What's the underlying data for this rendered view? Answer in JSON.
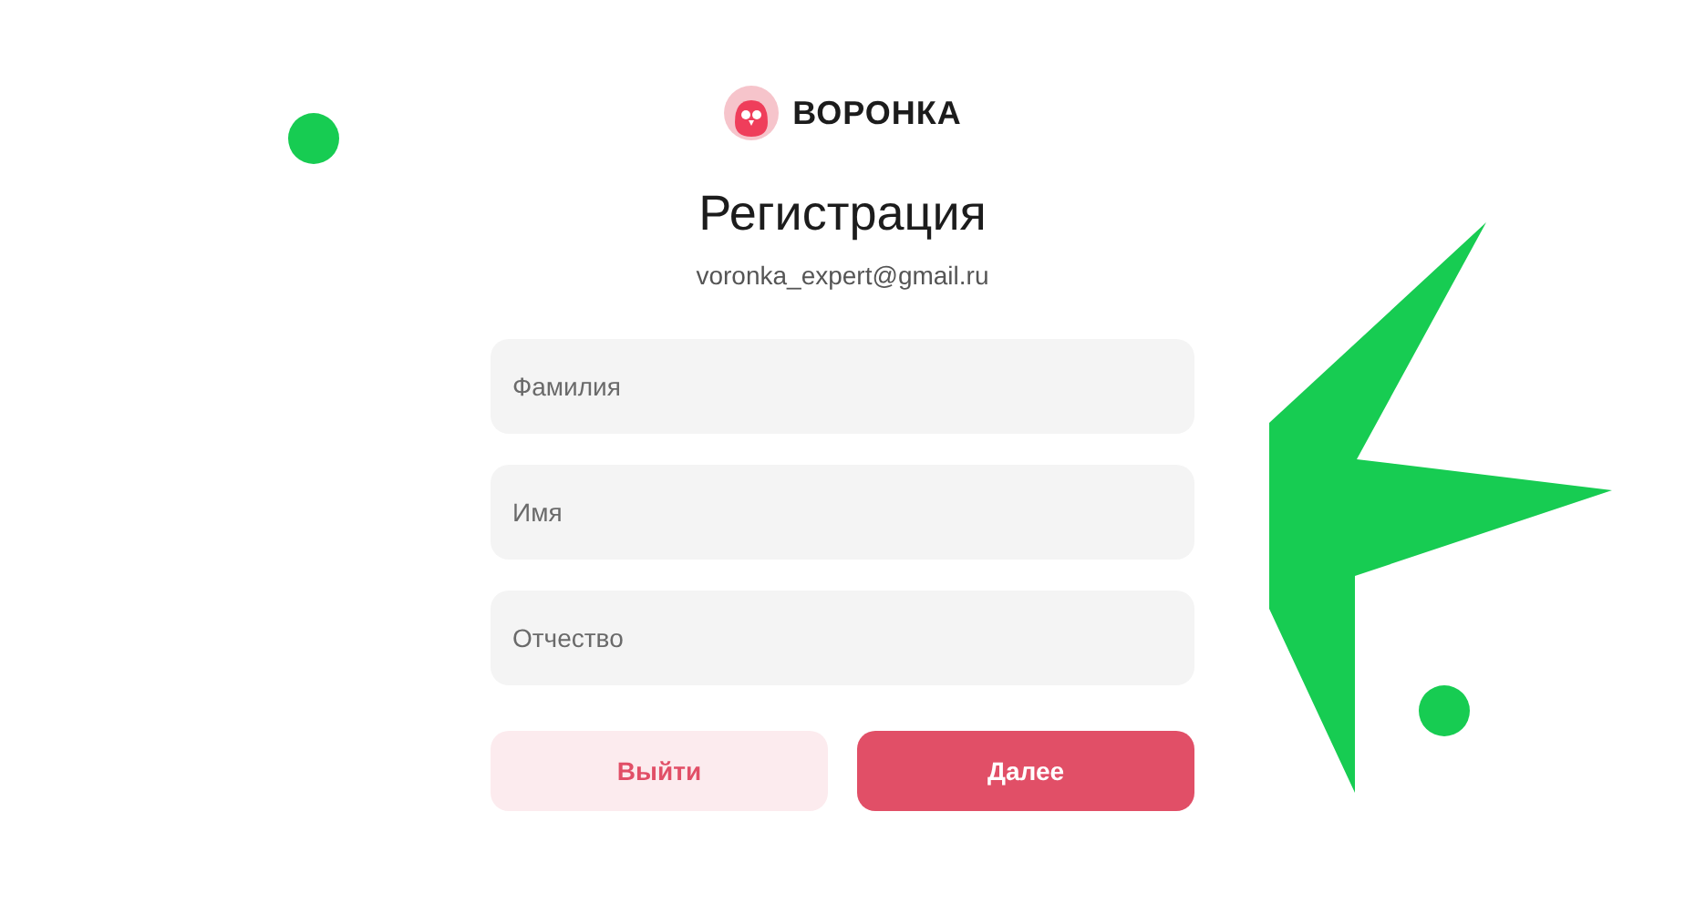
{
  "logo": {
    "text": "ВОРОНКА"
  },
  "title": "Регистрация",
  "email": "voronka_expert@gmail.ru",
  "fields": [
    {
      "placeholder": "Фамилия"
    },
    {
      "placeholder": "Имя"
    },
    {
      "placeholder": "Отчество"
    }
  ],
  "buttons": [
    {
      "label": "Выйти",
      "kind": "secondary"
    },
    {
      "label": "Далее",
      "kind": "primary"
    }
  ]
}
